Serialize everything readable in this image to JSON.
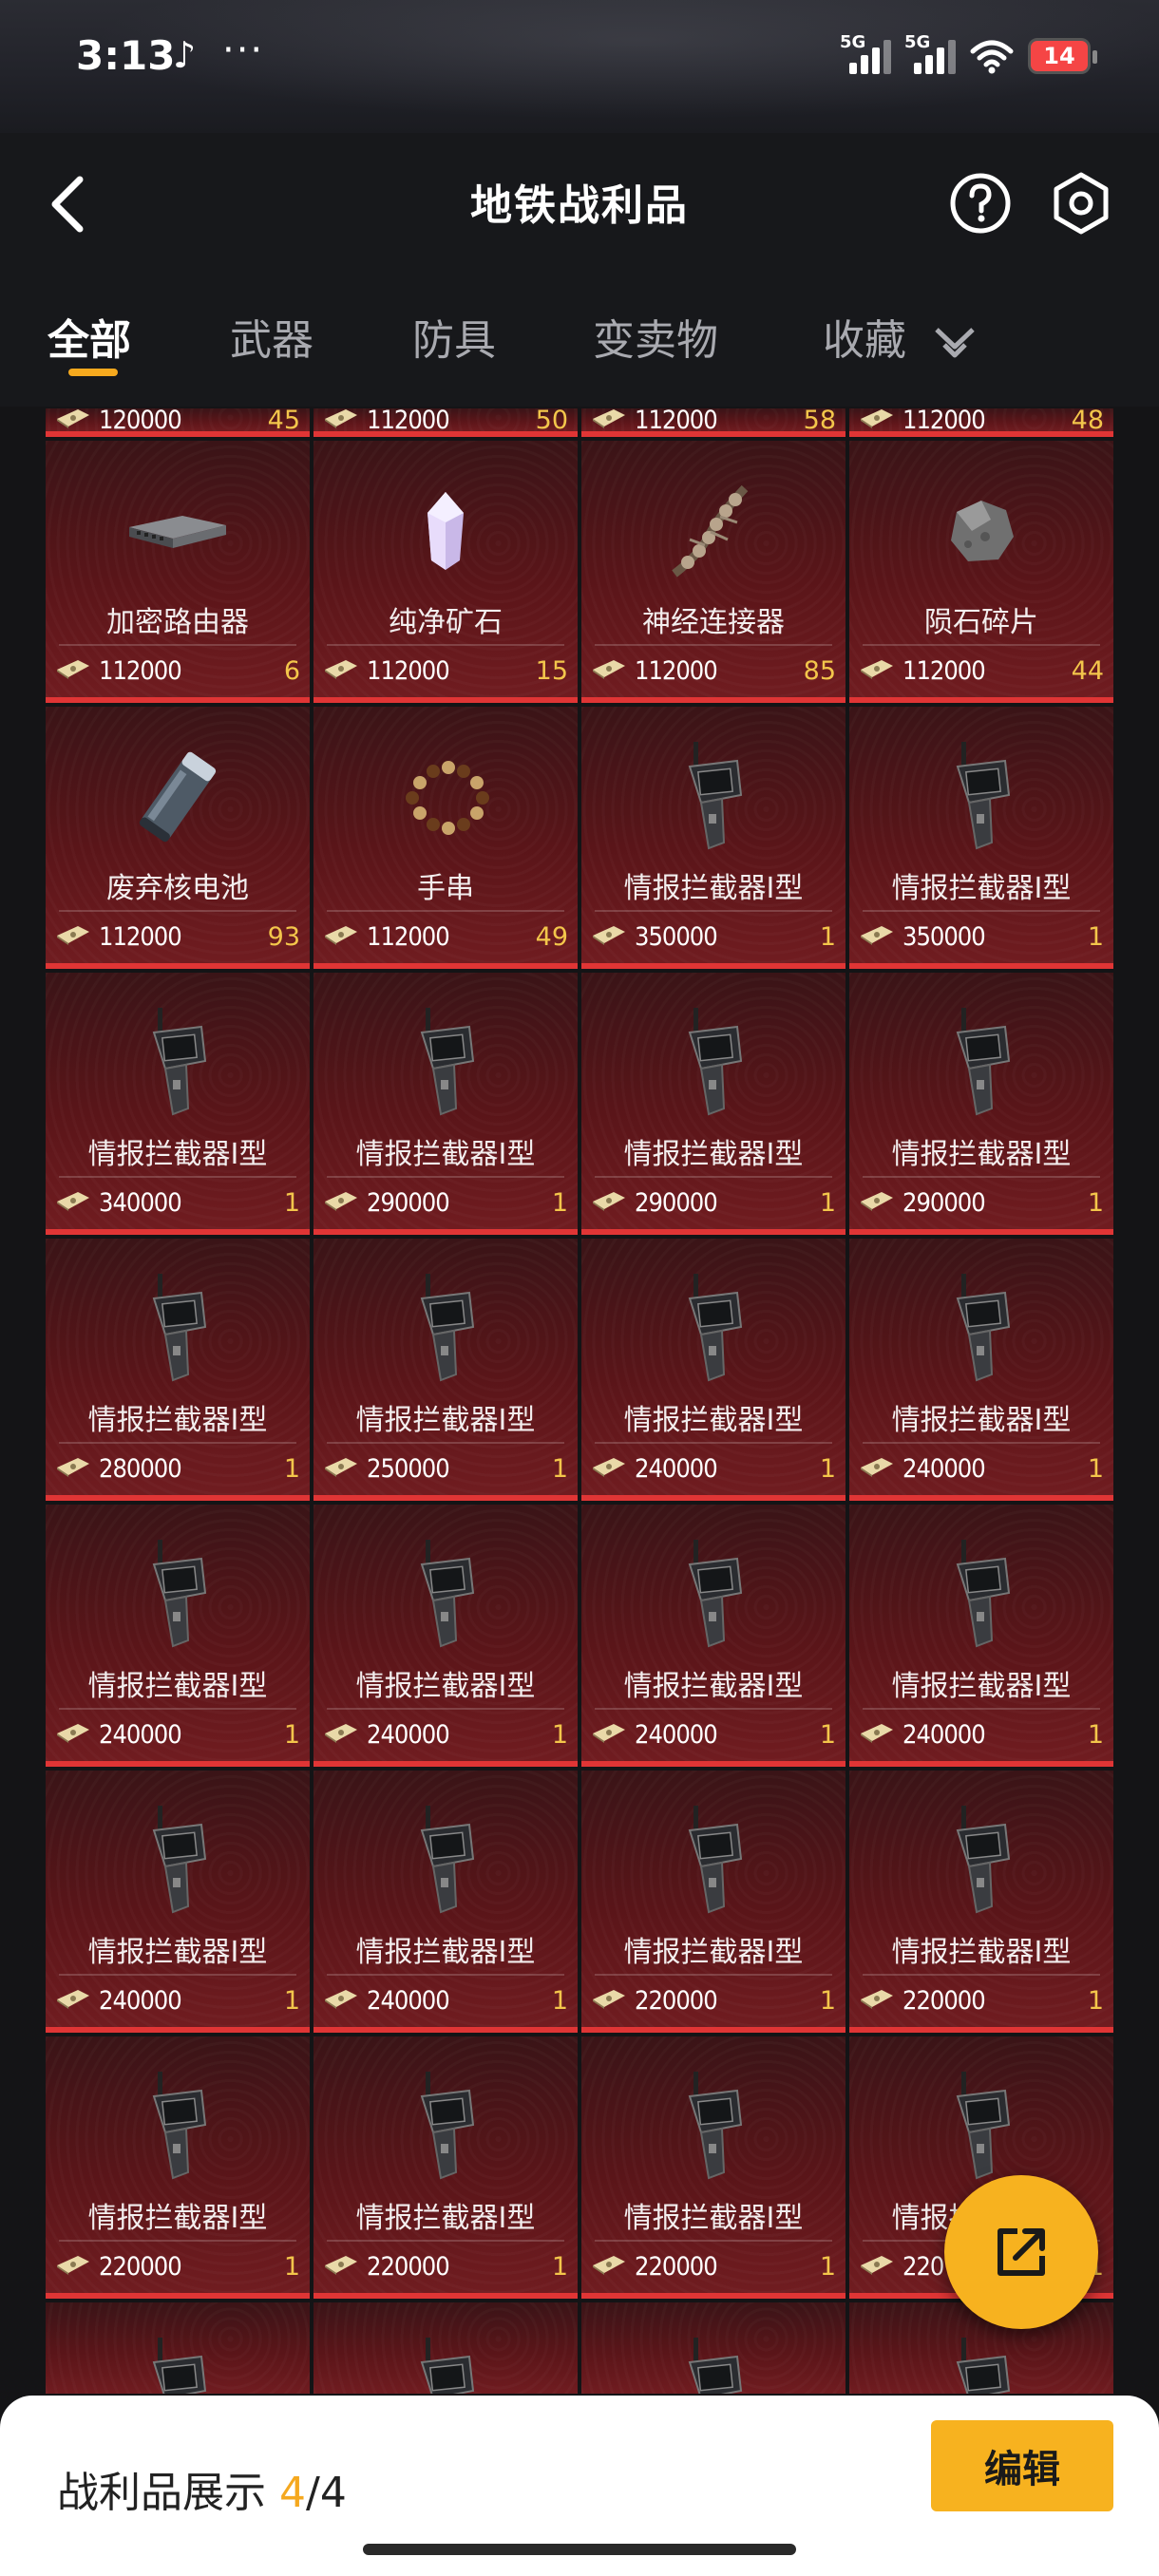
{
  "status_bar": {
    "time": "3:13",
    "app_glyph": "♪",
    "dots": "···",
    "net1": "5G",
    "net2": "5G",
    "battery": "14"
  },
  "header": {
    "title": "地铁战利品",
    "back_icon": "chevron-left-icon",
    "help_icon": "question-circle-icon",
    "settings_icon": "hexagon-gear-icon"
  },
  "tabs": [
    {
      "label": "全部",
      "active": true
    },
    {
      "label": "武器",
      "active": false
    },
    {
      "label": "防具",
      "active": false
    },
    {
      "label": "变卖物",
      "active": false
    },
    {
      "label": "收藏",
      "active": false
    }
  ],
  "partial_row": [
    {
      "price": "120000",
      "qty": "45"
    },
    {
      "price": "112000",
      "qty": "50"
    },
    {
      "price": "112000",
      "qty": "58"
    },
    {
      "price": "112000",
      "qty": "48"
    }
  ],
  "items": [
    {
      "name": "加密路由器",
      "price": "112000",
      "qty": "6",
      "icon": "router"
    },
    {
      "name": "纯净矿石",
      "price": "112000",
      "qty": "15",
      "icon": "crystal"
    },
    {
      "name": "神经连接器",
      "price": "112000",
      "qty": "85",
      "icon": "spine"
    },
    {
      "name": "陨石碎片",
      "price": "112000",
      "qty": "44",
      "icon": "rock"
    },
    {
      "name": "废弃核电池",
      "price": "112000",
      "qty": "93",
      "icon": "battery"
    },
    {
      "name": "手串",
      "price": "112000",
      "qty": "49",
      "icon": "beads"
    },
    {
      "name": "情报拦截器Ⅰ型",
      "price": "350000",
      "qty": "1",
      "icon": "interceptor"
    },
    {
      "name": "情报拦截器Ⅰ型",
      "price": "350000",
      "qty": "1",
      "icon": "interceptor"
    },
    {
      "name": "情报拦截器Ⅰ型",
      "price": "340000",
      "qty": "1",
      "icon": "interceptor"
    },
    {
      "name": "情报拦截器Ⅰ型",
      "price": "290000",
      "qty": "1",
      "icon": "interceptor"
    },
    {
      "name": "情报拦截器Ⅰ型",
      "price": "290000",
      "qty": "1",
      "icon": "interceptor"
    },
    {
      "name": "情报拦截器Ⅰ型",
      "price": "290000",
      "qty": "1",
      "icon": "interceptor"
    },
    {
      "name": "情报拦截器Ⅰ型",
      "price": "280000",
      "qty": "1",
      "icon": "interceptor"
    },
    {
      "name": "情报拦截器Ⅰ型",
      "price": "250000",
      "qty": "1",
      "icon": "interceptor"
    },
    {
      "name": "情报拦截器Ⅰ型",
      "price": "240000",
      "qty": "1",
      "icon": "interceptor"
    },
    {
      "name": "情报拦截器Ⅰ型",
      "price": "240000",
      "qty": "1",
      "icon": "interceptor"
    },
    {
      "name": "情报拦截器Ⅰ型",
      "price": "240000",
      "qty": "1",
      "icon": "interceptor"
    },
    {
      "name": "情报拦截器Ⅰ型",
      "price": "240000",
      "qty": "1",
      "icon": "interceptor"
    },
    {
      "name": "情报拦截器Ⅰ型",
      "price": "240000",
      "qty": "1",
      "icon": "interceptor"
    },
    {
      "name": "情报拦截器Ⅰ型",
      "price": "240000",
      "qty": "1",
      "icon": "interceptor"
    },
    {
      "name": "情报拦截器Ⅰ型",
      "price": "240000",
      "qty": "1",
      "icon": "interceptor"
    },
    {
      "name": "情报拦截器Ⅰ型",
      "price": "240000",
      "qty": "1",
      "icon": "interceptor"
    },
    {
      "name": "情报拦截器Ⅰ型",
      "price": "220000",
      "qty": "1",
      "icon": "interceptor"
    },
    {
      "name": "情报拦截器Ⅰ型",
      "price": "220000",
      "qty": "1",
      "icon": "interceptor"
    },
    {
      "name": "情报拦截器Ⅰ型",
      "price": "220000",
      "qty": "1",
      "icon": "interceptor"
    },
    {
      "name": "情报拦截器Ⅰ型",
      "price": "220000",
      "qty": "1",
      "icon": "interceptor"
    },
    {
      "name": "情报拦截器Ⅰ型",
      "price": "220000",
      "qty": "1",
      "icon": "interceptor"
    },
    {
      "name": "情报拦截器Ⅰ型",
      "price": "220",
      "qty": "1",
      "icon": "interceptor"
    }
  ],
  "cut_row_icons": [
    "interceptor",
    "interceptor",
    "interceptor",
    "interceptor"
  ],
  "bottom": {
    "label": "战利品展示 ",
    "current": "4",
    "sep": "/",
    "total": "4",
    "edit_label": "编辑"
  },
  "share_icon": "share-export-icon",
  "colors": {
    "accent": "#f7b21f",
    "card_border": "#e03535",
    "qty": "#f3c64b"
  }
}
